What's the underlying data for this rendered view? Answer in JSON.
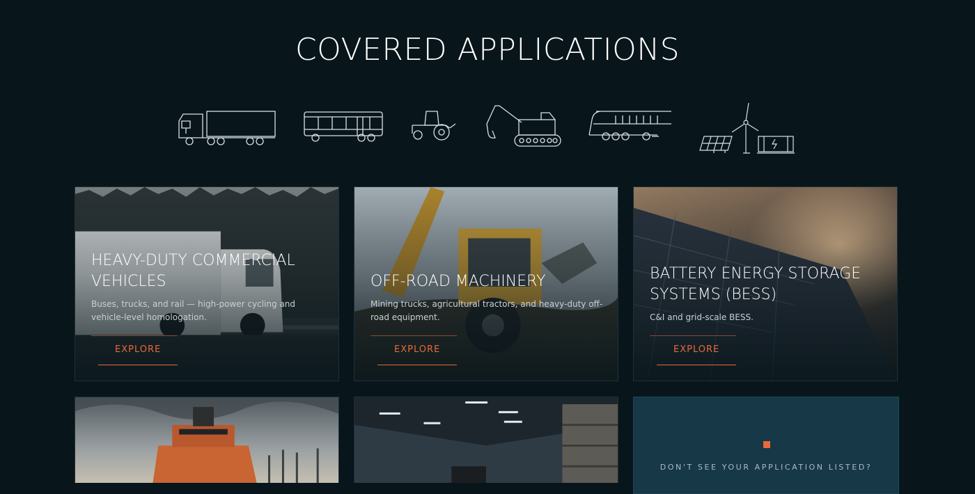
{
  "page": {
    "title": "COVERED APPLICATIONS"
  },
  "icons": [
    "truck-icon",
    "bus-icon",
    "tractor-icon",
    "excavator-icon",
    "train-icon",
    "solar-wind-battery-icon"
  ],
  "cards": [
    {
      "title_line1": "HEAVY-DUTY COMMERCIAL",
      "title_line2": "VEHICLES",
      "description": "Buses, trucks, and rail — high-power cycling and vehicle-level homologation.",
      "button": "EXPLORE"
    },
    {
      "title_line1": "OFF-ROAD MACHINERY",
      "title_line2": "",
      "description": "Mining trucks, agricultural tractors, and heavy-duty off-road equipment.",
      "button": "EXPLORE"
    },
    {
      "title_line1": "BATTERY ENERGY STORAGE",
      "title_line2": "SYSTEMS (BESS)",
      "description": "C&I and grid-scale BESS.",
      "button": "EXPLORE"
    }
  ],
  "cta": {
    "text": "DON'T SEE YOUR APPLICATION LISTED?"
  },
  "colors": {
    "background": "#08151a",
    "accent": "#e8693a",
    "cta_background": "#163847"
  }
}
